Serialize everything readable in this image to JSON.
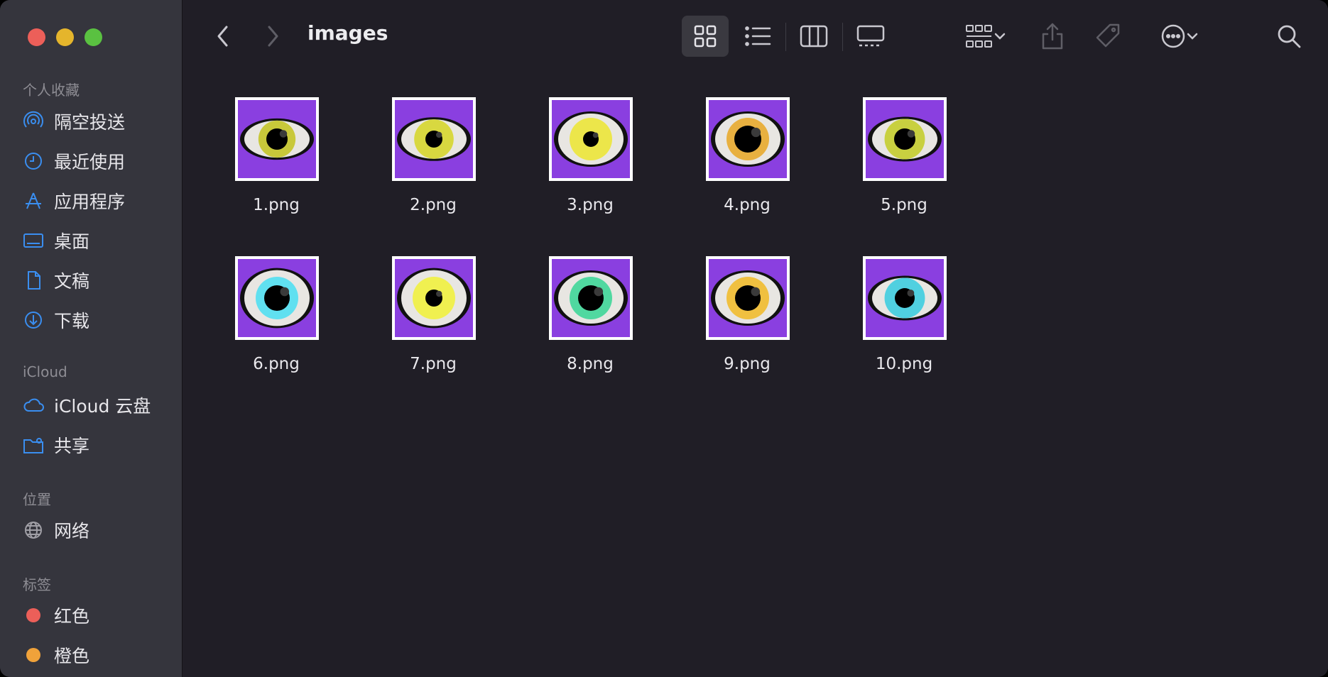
{
  "window": {
    "title": "images"
  },
  "sidebar": {
    "favorites_header": "个人收藏",
    "favorites": [
      {
        "label": "隔空投送",
        "icon": "airdrop-icon"
      },
      {
        "label": "最近使用",
        "icon": "clock-icon"
      },
      {
        "label": "应用程序",
        "icon": "applications-icon"
      },
      {
        "label": "桌面",
        "icon": "desktop-icon"
      },
      {
        "label": "文稿",
        "icon": "document-icon"
      },
      {
        "label": "下载",
        "icon": "download-icon"
      }
    ],
    "icloud_header": "iCloud",
    "icloud": [
      {
        "label": "iCloud 云盘",
        "icon": "cloud-icon"
      },
      {
        "label": "共享",
        "icon": "shared-folder-icon"
      }
    ],
    "locations_header": "位置",
    "locations": [
      {
        "label": "网络",
        "icon": "globe-icon"
      }
    ],
    "tags_header": "标签",
    "tags": [
      {
        "label": "红色",
        "color": "#ec5f59"
      },
      {
        "label": "橙色",
        "color": "#f0a23a"
      }
    ]
  },
  "toolbar": {
    "icons": [
      "back-icon",
      "forward-icon",
      "icon-view-icon",
      "list-view-icon",
      "column-view-icon",
      "gallery-view-icon",
      "group-icon",
      "share-icon",
      "tag-icon",
      "more-icon",
      "search-icon"
    ],
    "active_view": "icon-view"
  },
  "files": [
    {
      "name": "1.png"
    },
    {
      "name": "2.png"
    },
    {
      "name": "3.png"
    },
    {
      "name": "4.png"
    },
    {
      "name": "5.png"
    },
    {
      "name": "6.png"
    },
    {
      "name": "7.png"
    },
    {
      "name": "8.png"
    },
    {
      "name": "9.png"
    },
    {
      "name": "10.png"
    }
  ],
  "colors": {
    "thumbnail_background": "#8a3fe0",
    "sidebar_icon_blue": "#3a8ef0"
  }
}
